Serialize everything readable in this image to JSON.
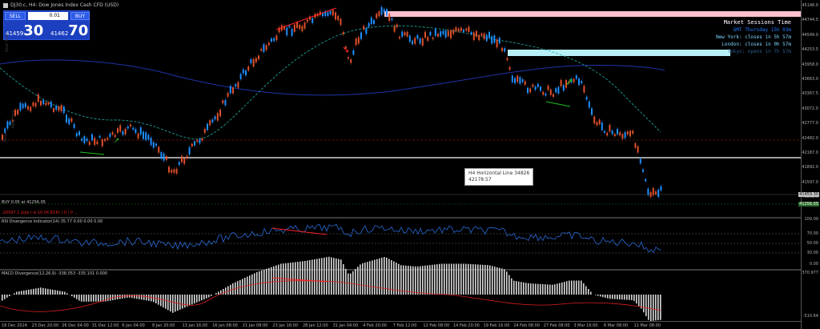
{
  "title": {
    "text": "DJ30.c, H4: Dow Jones Index Cash CFD (USD)"
  },
  "trade": {
    "sell_label": "SELL",
    "buy_label": "BUY",
    "lot_value": "0.01",
    "bid_small": "41459",
    "bid_big": "30",
    "ask_small": "41462",
    "ask_big": "70"
  },
  "sessions": {
    "heading": "Market Sessions Time",
    "gmt": "GMT Thursday 15h 03m",
    "new_york": "New York: closes in 5h 57m",
    "london": "London: closes in 0h 57m",
    "tokyo": "Tokyo: opens in 7h 57m"
  },
  "tooltip": {
    "line1": "H4 Horizontal Line 34826",
    "line2": "42178.57"
  },
  "labels": {
    "buy_order": "BUY 0.05 at 41256.05",
    "order_pnl": "-20097.1 pips (-$-10.04 EUR) | 0 | 0 ...",
    "rsi": "RSI Divergence Indicator(14) 35.77 0.00 0.00 0.00",
    "macd": "MACD Divergence(12,26,9) -338.053 -335.101 0.000",
    "left_sess1": "New York",
    "left_sess2": "New York",
    "left_sess3": "Tokyo"
  },
  "price_axis": [
    "45146.0",
    "44744.5",
    "44549.0",
    "44253.5",
    "43958.0",
    "43663.0",
    "43367.5",
    "43072.0",
    "42777.0",
    "42482.0",
    "42187.0",
    "41892.0",
    "41597.0",
    "41302.0"
  ],
  "price_tags": {
    "current": "41459.30",
    "hline": "41256.05"
  },
  "rsi_axis": [
    "100.00",
    "70.00",
    "50.00",
    "30.00",
    "0.00"
  ],
  "macd_axis": [
    "370.977",
    "-510.64"
  ],
  "time_axis": [
    "18 Dec 2024",
    "23 Dec 20:00",
    "26 Dec 04:00",
    "31 Dec 12:00",
    "6 Jan 04:00",
    "8 Jan 20:00",
    "13 Jan 16:00",
    "16 Jan 08:00",
    "21 Jan 08:00",
    "23 Jan 16:00",
    "28 Jan 12:00",
    "31 Jan 04:00",
    "4 Feb 20:00",
    "7 Feb 12:00",
    "12 Feb 08:00",
    "14 Feb 20:00",
    "19 Feb 16:00",
    "24 Feb 08:00",
    "27 Feb 08:00",
    "3 Mar 16:00",
    "6 Mar 08:00",
    "11 Mar 08:00"
  ],
  "colors": {
    "bull": "#1e90ff",
    "bear": "#e0502a",
    "pink_zone": "#ffc0cb",
    "cyan_zone": "#b8f0f8",
    "ma_slow": "#2233aa",
    "ma_fast": "#20b2aa"
  }
}
